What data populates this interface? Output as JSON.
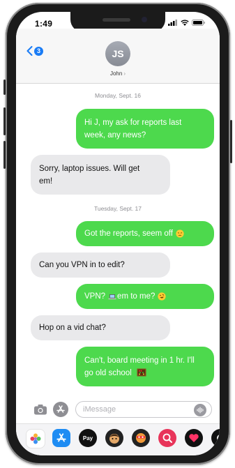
{
  "status": {
    "time": "1:49"
  },
  "header": {
    "back_count": "3",
    "avatar_initials": "JS",
    "contact_name": "John",
    "chevron": "›"
  },
  "conversation": {
    "dates": [
      "Monday, Sept. 16",
      "Tuesday, Sept. 17"
    ],
    "messages": [
      {
        "from": "me",
        "line1": "Hi J, my ask for reports last",
        "line2": "week, any news?"
      },
      {
        "from": "john",
        "line1": "Sorry, laptop issues. Will get",
        "line2": "em!"
      },
      {
        "from": "me",
        "text": "Got the reports, seem off",
        "emoji": "disappointed-face"
      },
      {
        "from": "john",
        "text": "Can you VPN in to edit?"
      },
      {
        "from": "me",
        "pre": "VPN?",
        "emoji1": "laptop",
        "post": "em to me?",
        "emoji2": "rofl-face"
      },
      {
        "from": "john",
        "text": "Hop on a vid chat?"
      },
      {
        "from": "me",
        "line1": "Can't, board meeting in 1 hr. I'll",
        "line2": "go old school",
        "emoji": "abacus"
      }
    ]
  },
  "composer": {
    "placeholder": "iMessage",
    "icons": [
      "camera-icon",
      "app-store-icon",
      "audio-waveform-icon"
    ]
  },
  "app_drawer": {
    "apple_pay_label": "Pay",
    "apps": [
      "photos",
      "app-store",
      "apple-pay",
      "memoji",
      "animoji",
      "search-images",
      "digital-touch",
      "music"
    ]
  },
  "colors": {
    "sent_bubble": "#4dd94d",
    "received_bubble": "#e9e9eb",
    "accent": "#1a7cf5"
  }
}
